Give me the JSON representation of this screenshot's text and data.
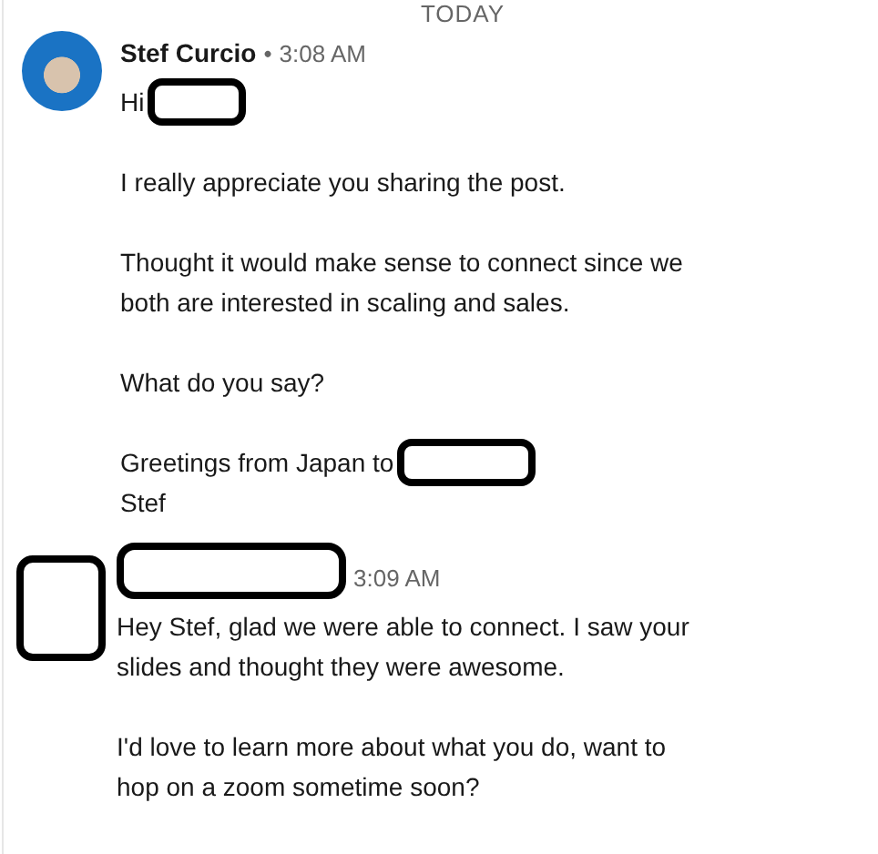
{
  "day_divider": "TODAY",
  "messages": [
    {
      "sender": "Stef Curcio",
      "sender_redacted": false,
      "avatar_redacted": false,
      "separator": "•",
      "time": "3:08 AM",
      "paragraphs": [
        [
          {
            "text": "Hi",
            "redacted": true
          }
        ],
        [
          {
            "text": "I really appreciate you sharing the post.",
            "redacted": false
          }
        ],
        [
          {
            "text": "Thought it would make sense to connect since we",
            "redacted": false
          },
          {
            "text": "both are interested in scaling and sales.",
            "redacted": false
          }
        ],
        [
          {
            "text": "What do you say?",
            "redacted": false
          }
        ],
        [
          {
            "text": "Greetings from Japan to",
            "redacted": true
          },
          {
            "text": "Stef",
            "redacted": false
          }
        ]
      ]
    },
    {
      "sender_redacted": true,
      "avatar_redacted": true,
      "time": "3:09 AM",
      "paragraphs": [
        [
          {
            "text": "Hey Stef, glad we were able to connect. I saw your",
            "redacted": false
          },
          {
            "text": "slides and thought they were awesome.",
            "redacted": false
          }
        ],
        [
          {
            "text": "I'd love to learn more about what you do, want to",
            "redacted": false
          },
          {
            "text": "hop on a zoom sometime soon?",
            "redacted": false
          }
        ]
      ]
    }
  ]
}
